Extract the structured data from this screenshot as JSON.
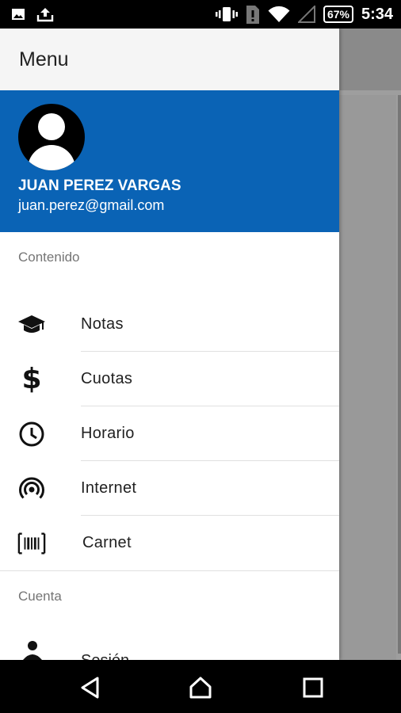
{
  "status_bar": {
    "battery": "67%",
    "time": "5:34"
  },
  "drawer": {
    "title": "Menu",
    "accent_color": "#0a63b5",
    "user": {
      "name": "JUAN PEREZ VARGAS",
      "email": "juan.perez@gmail.com"
    },
    "sections": [
      {
        "label": "Contenido",
        "items": [
          {
            "label": "Notas",
            "icon": "graduation-cap-icon"
          },
          {
            "label": "Cuotas",
            "icon": "dollar-icon"
          },
          {
            "label": "Horario",
            "icon": "clock-icon"
          },
          {
            "label": "Internet",
            "icon": "wifi-tethering-icon"
          },
          {
            "label": "Carnet",
            "icon": "barcode-icon"
          }
        ]
      },
      {
        "label": "Cuenta",
        "items": [
          {
            "label": "Sesión",
            "icon": "person-icon"
          }
        ]
      }
    ]
  }
}
